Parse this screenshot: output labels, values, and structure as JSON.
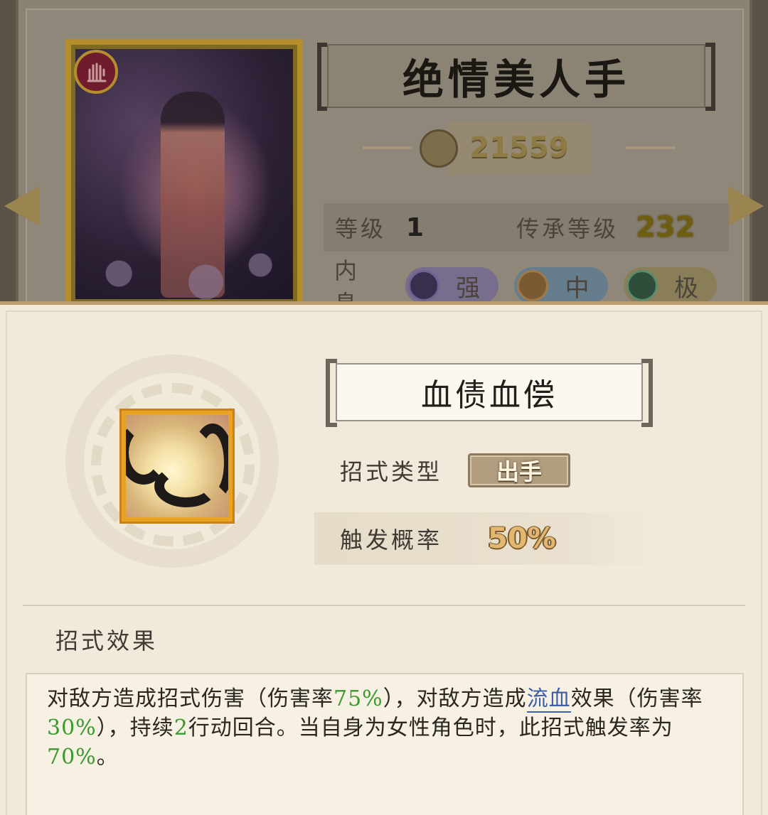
{
  "character": {
    "title": "绝情美人手",
    "power": "21559",
    "level_label": "等级",
    "level_value": "1",
    "inherit_label": "传承等级",
    "inherit_value": "232",
    "inner_label": "内息",
    "inner_pills": [
      {
        "label": "强",
        "icon": "purple-moon-orb"
      },
      {
        "label": "中",
        "icon": "bronze-sun-orb"
      },
      {
        "label": "极",
        "icon": "green-jade-orb"
      }
    ],
    "faction_icon": "crimson-hand-badge"
  },
  "skill": {
    "name": "血债血偿",
    "icon": "black-serpents-icon",
    "type_label": "招式类型",
    "type_value": "出手",
    "chance_label": "触发概率",
    "chance_value": "50%",
    "effect_heading": "招式效果",
    "effect": {
      "t1": "对敌方造成招式伤害（伤害率",
      "v1": "75%",
      "t2": "），对敌方造成",
      "keyword": "流血",
      "t3": "效果（伤害率",
      "v2": "30%",
      "t4": "），持续",
      "v3": "2",
      "t5": "行动回合。当自身为女性角色时，此招式触发率为",
      "v4": "70%",
      "t6": "。"
    }
  },
  "colors": {
    "highlight": "#3a9a2e",
    "keyword": "#3f5ea8",
    "gold_frame": "#b48e2c"
  }
}
